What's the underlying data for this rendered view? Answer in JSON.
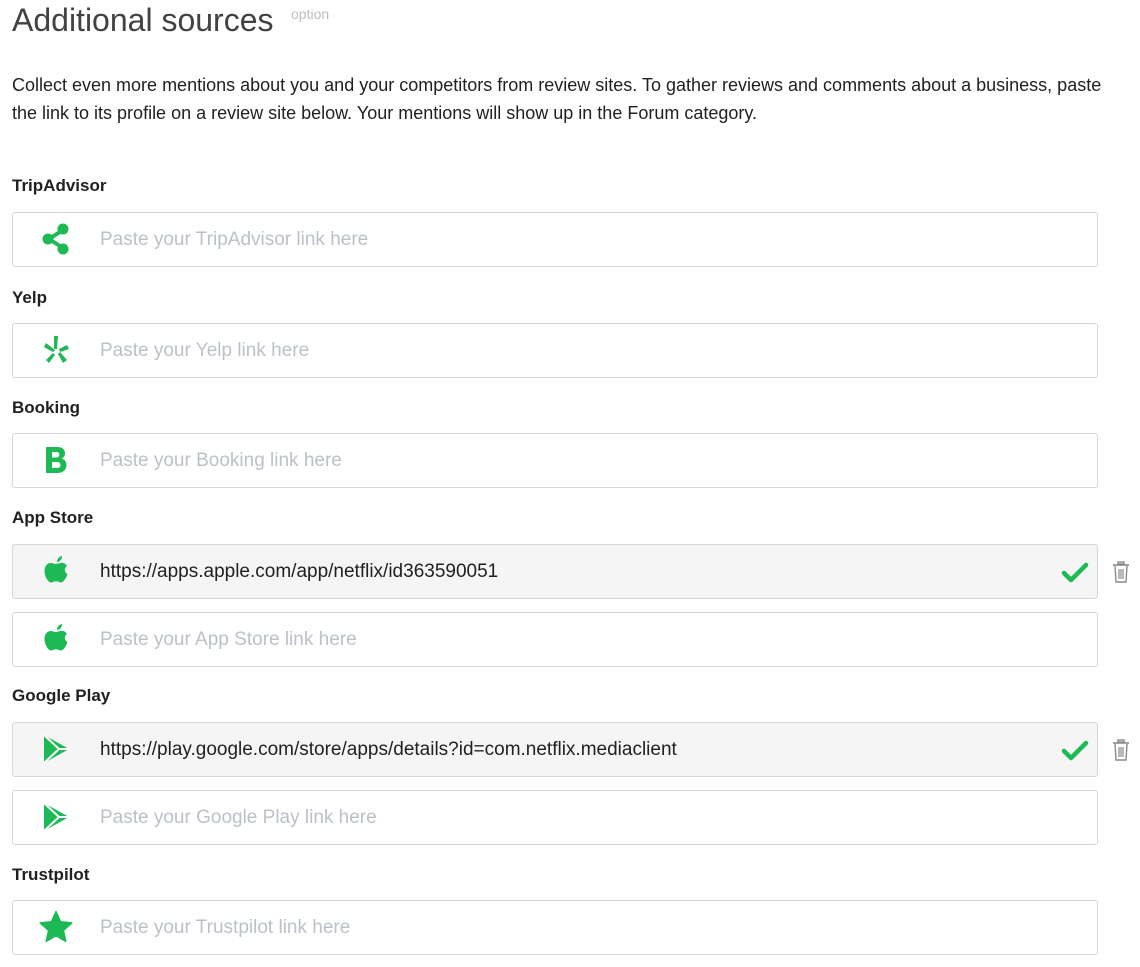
{
  "header": {
    "title": "Additional sources",
    "tag": "option"
  },
  "description": "Collect even more mentions about you and your competitors from review sites. To gather reviews and comments about a business, paste the link to its profile on a review site below. Your mentions will show up in the Forum category.",
  "colors": {
    "accent": "#1db954",
    "border": "#d6d6d6",
    "placeholder": "#bcc1c8",
    "filled_bg": "#f5f5f5"
  },
  "sources": {
    "tripadvisor": {
      "label": "TripAdvisor",
      "icon": "share-icon",
      "empty": {
        "placeholder": "Paste your TripAdvisor link here",
        "value": ""
      }
    },
    "yelp": {
      "label": "Yelp",
      "icon": "yelp-icon",
      "empty": {
        "placeholder": "Paste your Yelp link here",
        "value": ""
      }
    },
    "booking": {
      "label": "Booking",
      "icon": "booking-icon",
      "empty": {
        "placeholder": "Paste your Booking link here",
        "value": ""
      }
    },
    "appstore": {
      "label": "App Store",
      "icon": "apple-icon",
      "filled": {
        "value": "https://apps.apple.com/app/netflix/id363590051",
        "status": "valid"
      },
      "empty": {
        "placeholder": "Paste your App Store link here",
        "value": ""
      }
    },
    "googleplay": {
      "label": "Google Play",
      "icon": "google-play-icon",
      "filled": {
        "value": "https://play.google.com/store/apps/details?id=com.netflix.mediaclient",
        "status": "valid"
      },
      "empty": {
        "placeholder": "Paste your Google Play link here",
        "value": ""
      }
    },
    "trustpilot": {
      "label": "Trustpilot",
      "icon": "star-icon",
      "empty": {
        "placeholder": "Paste your Trustpilot link here",
        "value": ""
      }
    }
  }
}
